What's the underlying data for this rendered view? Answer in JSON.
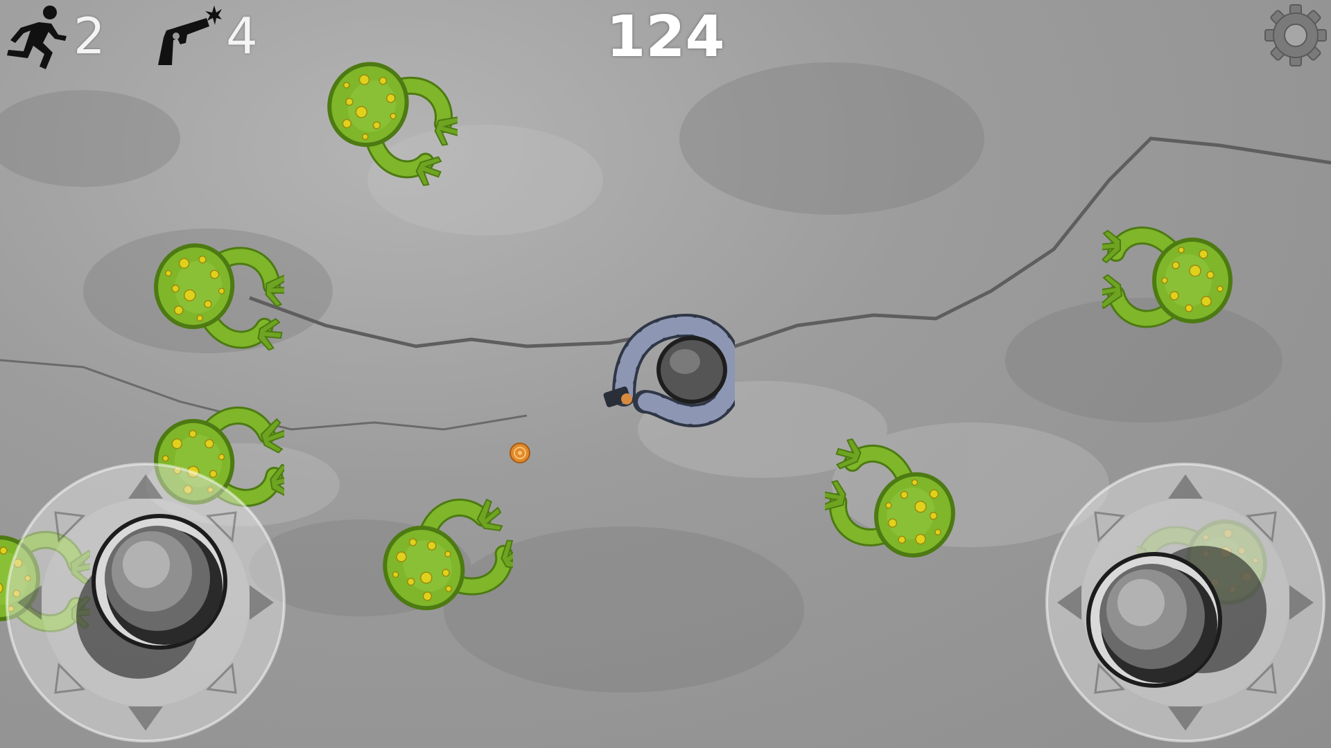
{
  "hud": {
    "lives": {
      "icon": "running-man-icon",
      "value": "2"
    },
    "ammo": {
      "icon": "pistol-icon",
      "value": "4"
    },
    "score": "124",
    "settings_icon": "gear-icon"
  },
  "entities": {
    "player": "player-character",
    "enemies": [
      "zombie",
      "zombie",
      "zombie",
      "zombie",
      "zombie",
      "zombie",
      "zombie",
      "zombie"
    ],
    "pickup": "coin"
  },
  "controls": {
    "left": "movement-joystick",
    "right": "aim-joystick"
  },
  "colors": {
    "ground": "#9c9c9c",
    "zombie_skin": "#7fb62a",
    "zombie_spots": "#e0d21c",
    "coin": "#e08a2c",
    "hud_text": "#ffffff"
  }
}
